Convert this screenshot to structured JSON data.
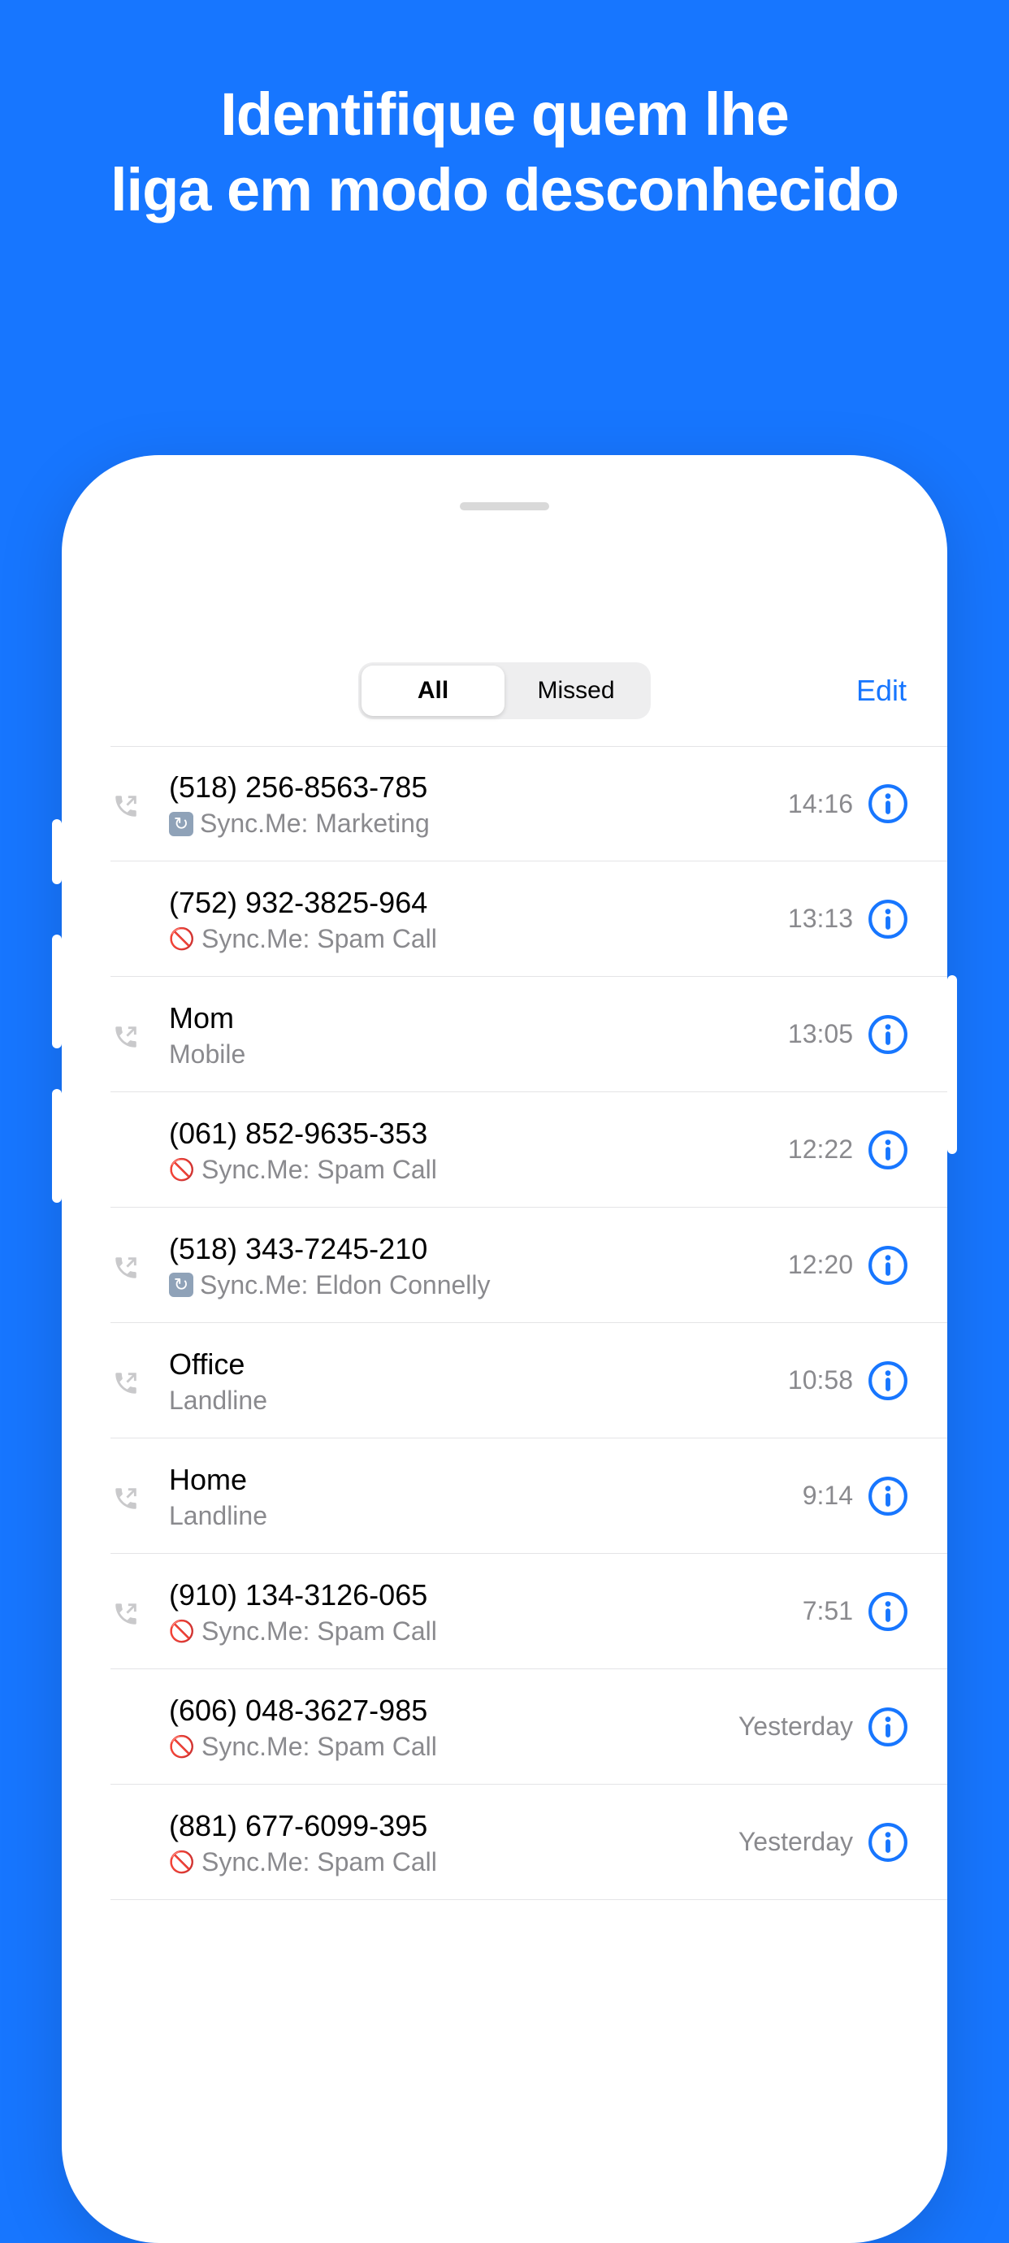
{
  "headline": {
    "line1": "Identifique quem lhe",
    "line2": "liga em modo desconhecido"
  },
  "topbar": {
    "tabs": {
      "all": "All",
      "missed": "Missed"
    },
    "edit": "Edit"
  },
  "calls": [
    {
      "title": "(518) 256-8563-785",
      "sub": "Sync.Me: Marketing",
      "subicon": "sync",
      "time": "14:16",
      "outgoing": true
    },
    {
      "title": "(752) 932-3825-964",
      "sub": "Sync.Me: Spam Call",
      "subicon": "block",
      "time": "13:13",
      "outgoing": false
    },
    {
      "title": "Mom",
      "sub": "Mobile",
      "subicon": "",
      "time": "13:05",
      "outgoing": true
    },
    {
      "title": "(061) 852-9635-353",
      "sub": "Sync.Me: Spam Call",
      "subicon": "block",
      "time": "12:22",
      "outgoing": false
    },
    {
      "title": "(518) 343-7245-210",
      "sub": "Sync.Me: Eldon Connelly",
      "subicon": "sync",
      "time": "12:20",
      "outgoing": true
    },
    {
      "title": "Office",
      "sub": "Landline",
      "subicon": "",
      "time": "10:58",
      "outgoing": true
    },
    {
      "title": "Home",
      "sub": "Landline",
      "subicon": "",
      "time": "9:14",
      "outgoing": true
    },
    {
      "title": "(910) 134-3126-065",
      "sub": "Sync.Me: Spam Call",
      "subicon": "block",
      "time": "7:51",
      "outgoing": true
    },
    {
      "title": "(606) 048-3627-985",
      "sub": "Sync.Me: Spam Call",
      "subicon": "block",
      "time": "Yesterday",
      "outgoing": false
    },
    {
      "title": "(881) 677-6099-395",
      "sub": "Sync.Me: Spam Call",
      "subicon": "block",
      "time": "Yesterday",
      "outgoing": false
    }
  ]
}
